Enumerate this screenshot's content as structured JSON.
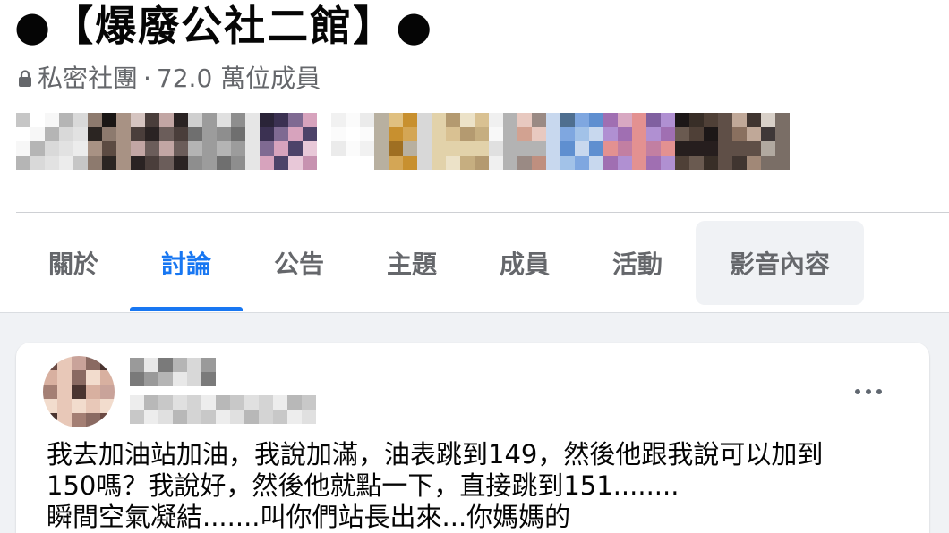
{
  "group": {
    "title": "●【爆廢公社二館】●",
    "privacy_icon": "lock-icon",
    "privacy": "私密社團",
    "separator": "·",
    "members_count": "72.0 萬位成員"
  },
  "tabs": [
    {
      "label": "關於",
      "active": false,
      "hovered": false
    },
    {
      "label": "討論",
      "active": true,
      "hovered": false
    },
    {
      "label": "公告",
      "active": false,
      "hovered": false
    },
    {
      "label": "主題",
      "active": false,
      "hovered": false
    },
    {
      "label": "成員",
      "active": false,
      "hovered": false
    },
    {
      "label": "活動",
      "active": false,
      "hovered": false
    },
    {
      "label": "影音內容",
      "active": false,
      "hovered": true
    }
  ],
  "post": {
    "more_icon": "more-horizontal-icon",
    "text_lines": [
      "我去加油站加油，我說加滿，油表跳到149，然後他跟我說可以加到",
      "150嗎？我說好，然後他就點一下，直接跳到151........",
      "瞬間空氣凝結.......叫你們站長出來...你媽媽的"
    ]
  },
  "colors": {
    "accent": "#1877F2",
    "text_primary": "#050505",
    "text_secondary": "#65676B",
    "page_background": "#F0F2F5",
    "hover_background": "#F0F2F5",
    "divider": "#CED0D4"
  }
}
